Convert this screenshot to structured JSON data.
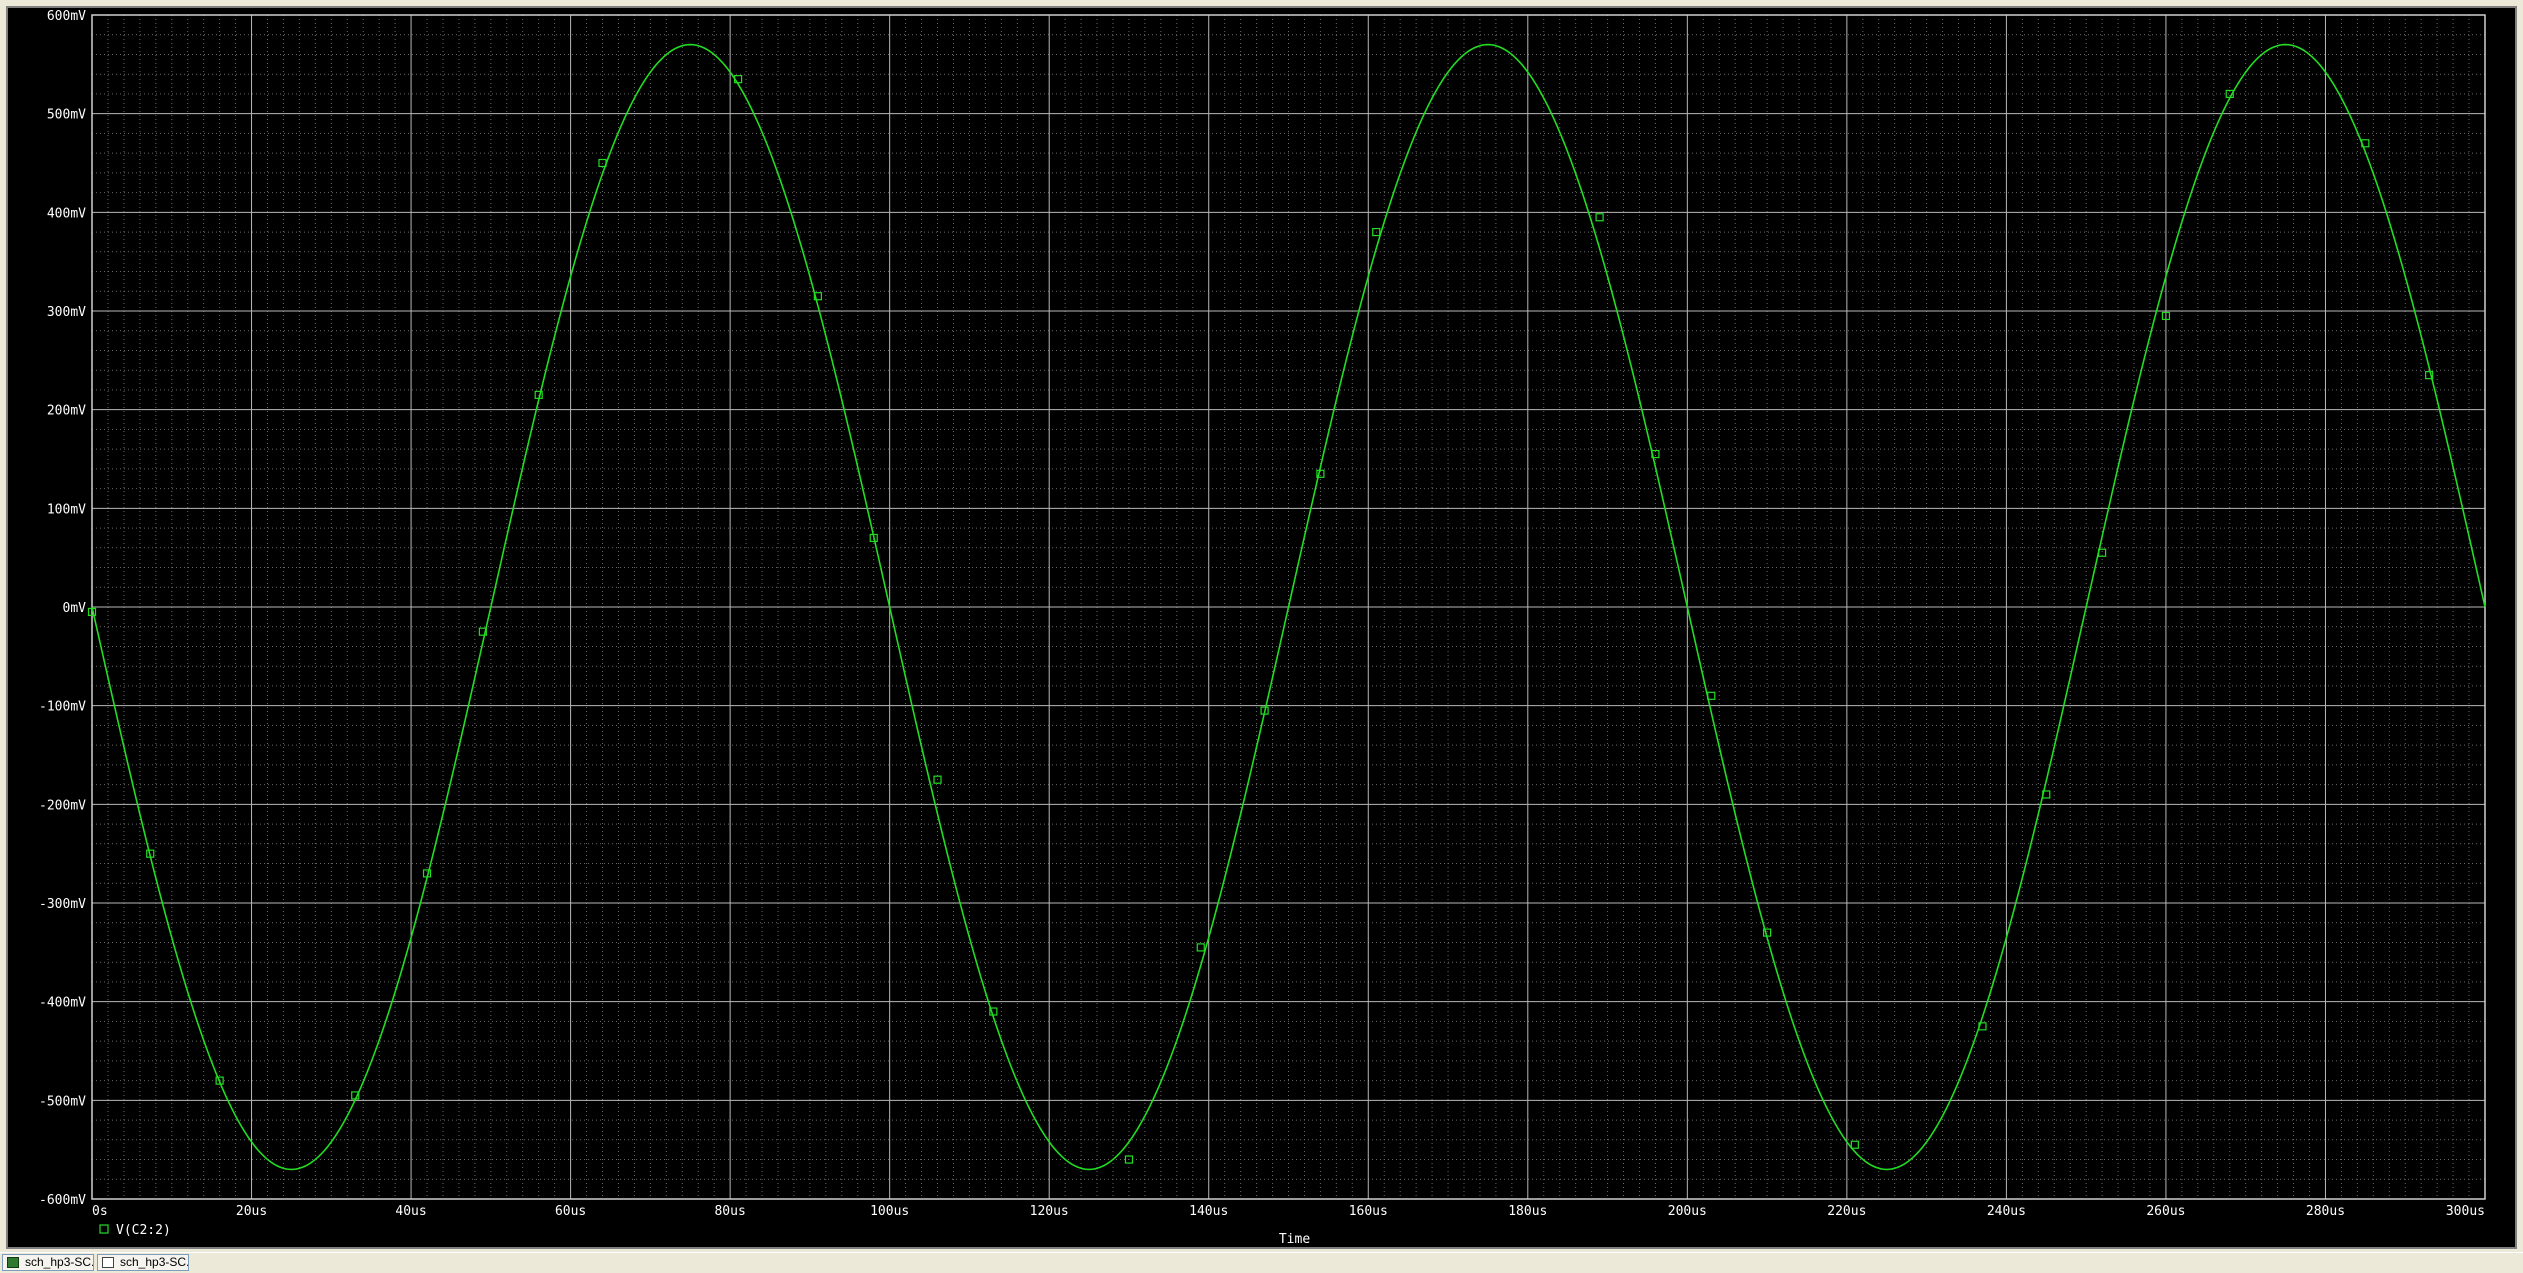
{
  "colors": {
    "background": "#000000",
    "grid_major": "#b8b8b8",
    "grid_minor": "#6a6a6a",
    "axis_text": "#ffffff",
    "trace": "#22dd22",
    "window": "#ece9d8"
  },
  "chart_data": {
    "type": "line",
    "xlabel": "Time",
    "ylabel": "",
    "title": "",
    "x_unit": "us",
    "y_unit": "mV",
    "xlim": [
      0,
      300
    ],
    "ylim": [
      -600,
      600
    ],
    "grid": true,
    "legend_position": "bottom-left",
    "x_ticks": [
      0,
      20,
      40,
      60,
      80,
      100,
      120,
      140,
      160,
      180,
      200,
      220,
      240,
      260,
      280,
      300
    ],
    "x_tick_labels": [
      "0s",
      "20us",
      "40us",
      "60us",
      "80us",
      "100us",
      "120us",
      "140us",
      "160us",
      "180us",
      "200us",
      "220us",
      "240us",
      "260us",
      "280us",
      "300us"
    ],
    "y_ticks": [
      600,
      500,
      400,
      300,
      200,
      100,
      0,
      -100,
      -200,
      -300,
      -400,
      -500,
      -600
    ],
    "y_tick_labels": [
      "600mV",
      "500mV",
      "400mV",
      "300mV",
      "200mV",
      "100mV",
      "0mV",
      "-100mV",
      "-200mV",
      "-300mV",
      "-400mV",
      "-500mV",
      "-600mV"
    ],
    "series": [
      {
        "name": "V(C2:2)",
        "marker": "square",
        "amplitude_mV": 570,
        "period_us": 100,
        "phase_deg": 180,
        "x": [
          0,
          6.25,
          12.5,
          18.75,
          25,
          31.25,
          37.5,
          43.75,
          50,
          56.25,
          62.5,
          68.75,
          75,
          81.25,
          87.5,
          93.75,
          100,
          106.25,
          112.5,
          118.75,
          125,
          131.25,
          137.5,
          143.75,
          150,
          156.25,
          162.5,
          168.75,
          175,
          181.25,
          187.5,
          193.75,
          200,
          206.25,
          212.5,
          218.75,
          225,
          231.25,
          237.5,
          243.75,
          250,
          256.25,
          262.5,
          268.75,
          275,
          281.25,
          287.5,
          293.75,
          300
        ],
        "y": [
          0,
          -218,
          -403,
          -527,
          -570,
          -527,
          -403,
          -218,
          0,
          218,
          403,
          527,
          570,
          527,
          403,
          218,
          0,
          -218,
          -403,
          -527,
          -570,
          -527,
          -403,
          -218,
          0,
          218,
          403,
          527,
          570,
          527,
          403,
          218,
          0,
          -218,
          -403,
          -527,
          -570,
          -527,
          -403,
          -218,
          0,
          218,
          403,
          527,
          570,
          527,
          403,
          218,
          0
        ],
        "marker_x": [
          0,
          7.3,
          16,
          33,
          42,
          49,
          56,
          64,
          81,
          91,
          98,
          106,
          113,
          130,
          139,
          147,
          154,
          161,
          189,
          196,
          203,
          210,
          221,
          237,
          245,
          252,
          260,
          268,
          285,
          293
        ],
        "marker_y": [
          -5,
          -250,
          -480,
          -495,
          -270,
          -25,
          215,
          450,
          535,
          315,
          70,
          -175,
          -410,
          -560,
          -345,
          -105,
          135,
          380,
          395,
          155,
          -90,
          -330,
          -545,
          -425,
          -190,
          55,
          295,
          520,
          470,
          235
        ]
      }
    ]
  },
  "legend": {
    "label": "V(C2:2)"
  },
  "taskbar": {
    "tabs": [
      {
        "label": "sch_hp3-SC..."
      },
      {
        "label": "sch_hp3-SC..."
      }
    ]
  }
}
